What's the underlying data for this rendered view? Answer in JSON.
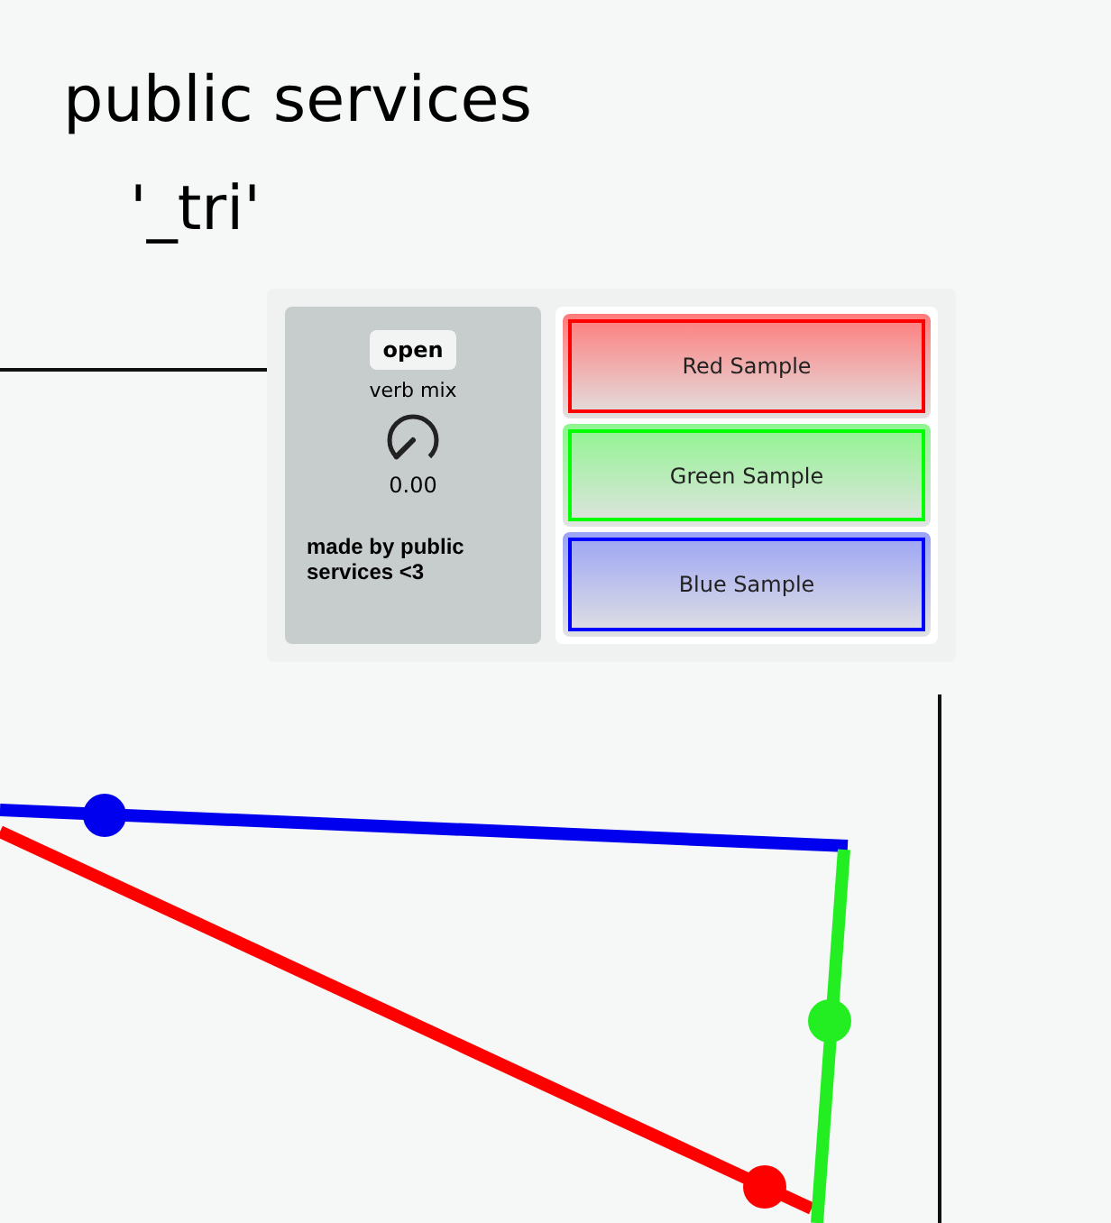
{
  "title": "public services",
  "subtitle": "'_tri'",
  "panel": {
    "open_button": "open",
    "knob": {
      "label": "verb mix",
      "value": "0.00"
    },
    "credit": "made by public services <3"
  },
  "samples": [
    {
      "label": "Red Sample",
      "color": "#ff0000"
    },
    {
      "label": "Green Sample",
      "color": "#00ff00"
    },
    {
      "label": "Blue Sample",
      "color": "#0000ff"
    }
  ]
}
